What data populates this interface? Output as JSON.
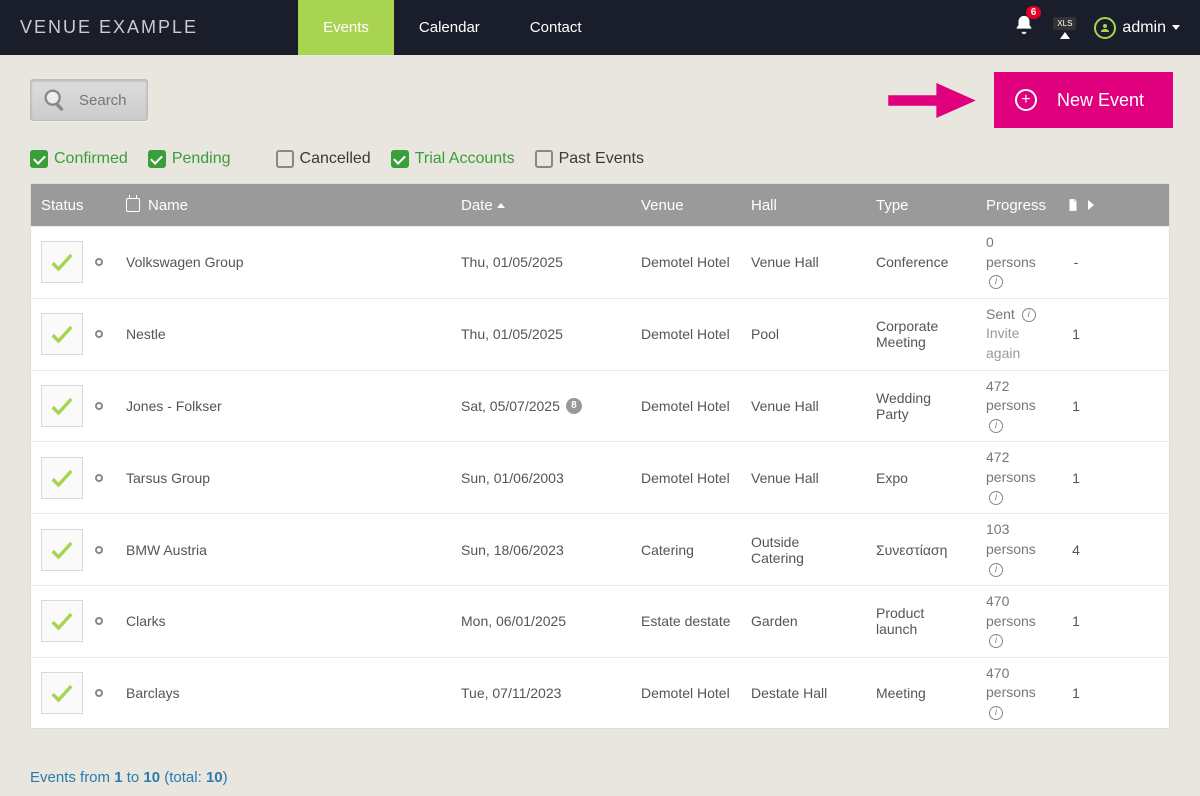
{
  "brand": "VENUE EXAMPLE",
  "nav": {
    "events": "Events",
    "calendar": "Calendar",
    "contact": "Contact"
  },
  "notifications": "6",
  "xls_label": "XLS",
  "user": "admin",
  "search_label": "Search",
  "new_event_label": "New Event",
  "filters": {
    "confirmed": "Confirmed",
    "pending": "Pending",
    "cancelled": "Cancelled",
    "trial": "Trial Accounts",
    "past": "Past Events"
  },
  "columns": {
    "status": "Status",
    "name": "Name",
    "date": "Date",
    "venue": "Venue",
    "hall": "Hall",
    "type": "Type",
    "progress": "Progress"
  },
  "rows": [
    {
      "name": "Volkswagen Group",
      "date": "Thu, 01/05/2025",
      "date_badge": "",
      "venue": "Demotel Hotel",
      "hall": "Venue Hall",
      "type": "Conference",
      "progress": "0 persons",
      "progress_extra": "",
      "count": "-"
    },
    {
      "name": "Nestle",
      "date": "Thu, 01/05/2025",
      "date_badge": "",
      "venue": "Demotel Hotel",
      "hall": "Pool",
      "type": "Corporate Meeting",
      "progress": "Sent",
      "progress_extra": "Invite again",
      "count": "1"
    },
    {
      "name": "Jones - Folkser",
      "date": "Sat, 05/07/2025",
      "date_badge": "8",
      "venue": "Demotel Hotel",
      "hall": "Venue Hall",
      "type": "Wedding Party",
      "progress": "472 persons",
      "progress_extra": "",
      "count": "1"
    },
    {
      "name": "Tarsus Group",
      "date": "Sun, 01/06/2003",
      "date_badge": "",
      "venue": "Demotel Hotel",
      "hall": "Venue Hall",
      "type": "Expo",
      "progress": "472 persons",
      "progress_extra": "",
      "count": "1"
    },
    {
      "name": "BMW Austria",
      "date": "Sun, 18/06/2023",
      "date_badge": "",
      "venue": "Catering",
      "hall": "Outside Catering",
      "type": "Συνεστίαση",
      "progress": "103 persons",
      "progress_extra": "",
      "count": "4"
    },
    {
      "name": "Clarks",
      "date": "Mon, 06/01/2025",
      "date_badge": "",
      "venue": "Estate destate",
      "hall": "Garden",
      "type": "Product launch",
      "progress": "470 persons",
      "progress_extra": "",
      "count": "1"
    },
    {
      "name": "Barclays",
      "date": "Tue, 07/11/2023",
      "date_badge": "",
      "venue": "Demotel Hotel",
      "hall": "Destate Hall",
      "type": "Meeting",
      "progress": "470 persons",
      "progress_extra": "",
      "count": "1"
    }
  ],
  "footer": {
    "prefix": "Events from ",
    "from": "1",
    "mid": " to ",
    "to": "10",
    "total_prefix": " (total: ",
    "total": "10",
    "suffix": ")"
  }
}
